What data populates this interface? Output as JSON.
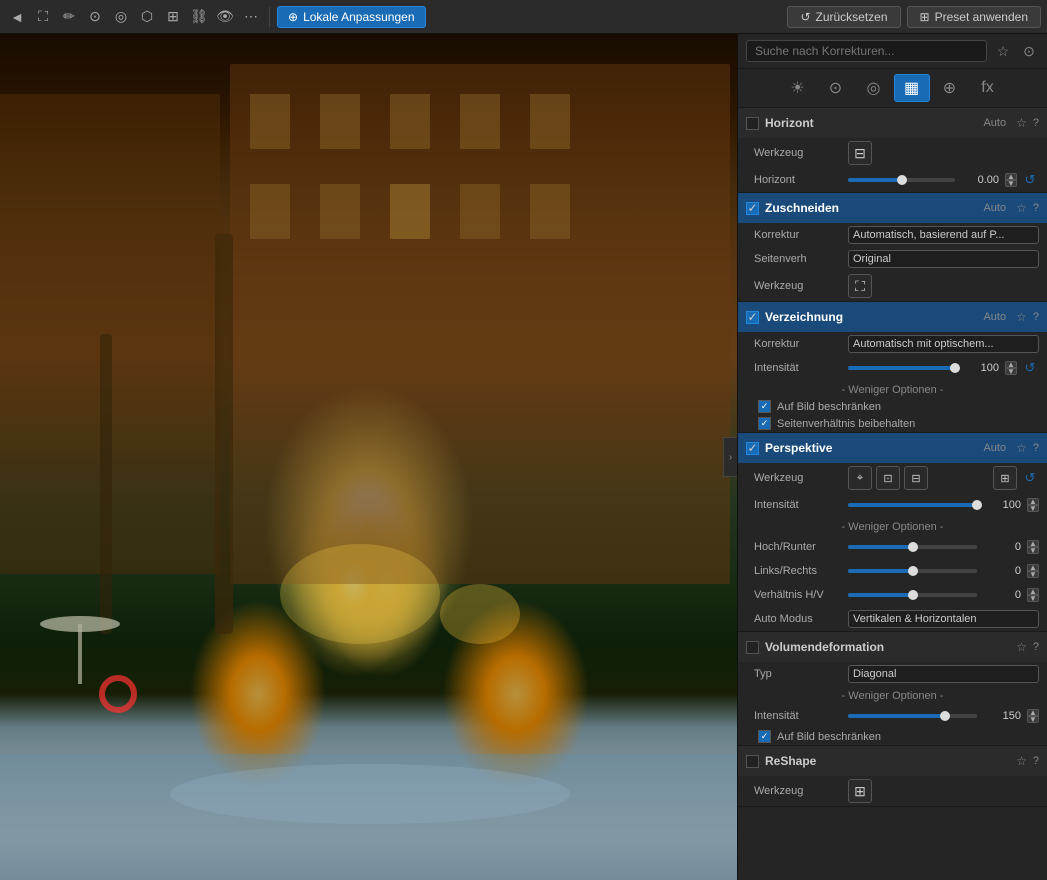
{
  "toolbar": {
    "active_tool": "Lokale Anpassungen",
    "reset_button": "Zurücksetzen",
    "preset_button": "Preset anwenden"
  },
  "search": {
    "placeholder": "Suche nach Korrekturen..."
  },
  "categories": [
    {
      "id": "sun",
      "label": "Belichtung",
      "icon": "☀",
      "active": false
    },
    {
      "id": "person",
      "label": "Farbe",
      "icon": "⊙",
      "active": false
    },
    {
      "id": "circle",
      "label": "Detail",
      "icon": "◎",
      "active": false
    },
    {
      "id": "grid",
      "label": "Geometrie",
      "icon": "▦",
      "active": true
    },
    {
      "id": "dots",
      "label": "Optionen",
      "icon": "⊕",
      "active": false
    },
    {
      "id": "fx",
      "label": "Effekte",
      "icon": "fx",
      "active": false
    }
  ],
  "sections": {
    "horizont": {
      "title": "Horizont",
      "auto": "Auto",
      "enabled": false,
      "werkzeug_label": "Werkzeug",
      "horizont_label": "Horizont",
      "horizont_value": "0.00"
    },
    "zuschneiden": {
      "title": "Zuschneiden",
      "auto": "Auto",
      "enabled": true,
      "korrektur_label": "Korrektur",
      "korrektur_value": "Automatisch, basierend auf P...",
      "seitenverh_label": "Seitenverh",
      "seitenverh_value": "Original",
      "werkzeug_label": "Werkzeug"
    },
    "verzeichnung": {
      "title": "Verzeichnung",
      "auto": "Auto",
      "enabled": true,
      "korrektur_label": "Korrektur",
      "korrektur_value": "Automatisch mit optischem...",
      "intensitaet_label": "Intensität",
      "intensitaet_value": "100",
      "intensitaet_pct": 100,
      "less_options": "- Weniger Optionen -",
      "cb1_label": "Auf Bild beschränken",
      "cb2_label": "Seitenverhältnis beibehalten"
    },
    "perspektive": {
      "title": "Perspektive",
      "auto": "Auto",
      "enabled": true,
      "werkzeug_label": "Werkzeug",
      "intensitaet_label": "Intensität",
      "intensitaet_value": "100",
      "intensitaet_pct": 100,
      "less_options": "- Weniger Optionen -",
      "hochrunter_label": "Hoch/Runter",
      "hochrunter_value": "0",
      "linksrechts_label": "Links/Rechts",
      "linksrechts_value": "0",
      "verhaeltnis_label": "Verhältnis H/V",
      "verhaeltnis_value": "0",
      "automodus_label": "Auto Modus",
      "automodus_value": "Vertikalen & Horizontalen"
    },
    "volumendeformation": {
      "title": "Volumendeformation",
      "enabled": false,
      "typ_label": "Typ",
      "typ_value": "Diagonal",
      "less_options": "- Weniger Optionen -",
      "intensitaet_label": "Intensität",
      "intensitaet_value": "150",
      "intensitaet_pct": 75,
      "cb1_label": "Auf Bild beschränken"
    },
    "reshape": {
      "title": "ReShape",
      "enabled": false,
      "werkzeug_label": "Werkzeug"
    }
  }
}
